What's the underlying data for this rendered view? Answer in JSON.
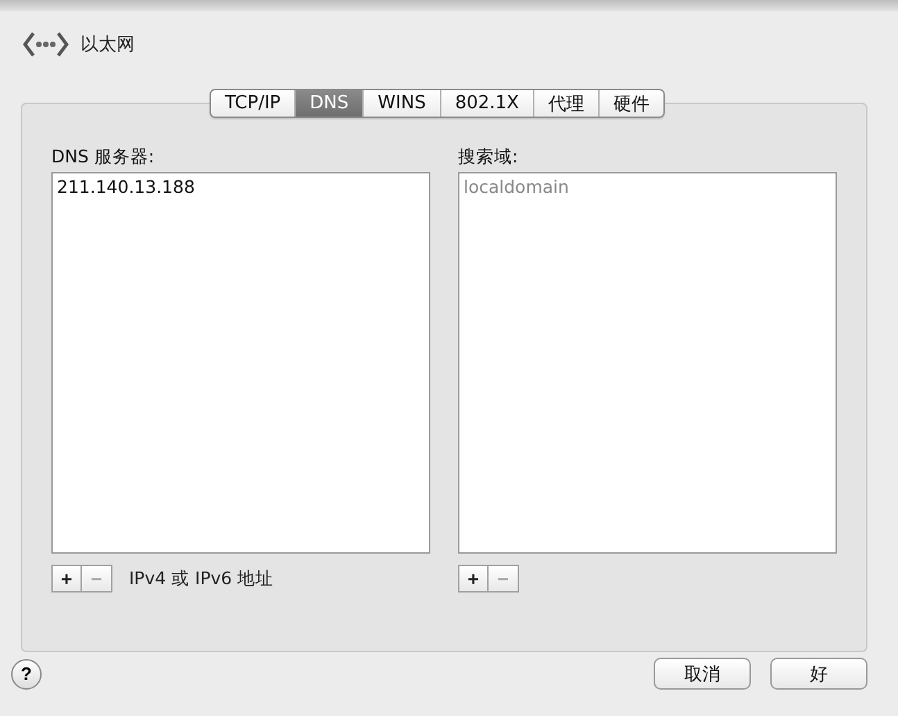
{
  "header": {
    "title": "以太网"
  },
  "tabs": [
    {
      "label": "TCP/IP",
      "selected": false
    },
    {
      "label": "DNS",
      "selected": true
    },
    {
      "label": "WINS",
      "selected": false
    },
    {
      "label": "802.1X",
      "selected": false
    },
    {
      "label": "代理",
      "selected": false
    },
    {
      "label": "硬件",
      "selected": false
    }
  ],
  "dns_servers": {
    "label": "DNS 服务器:",
    "items": [
      {
        "text": "211.140.13.188",
        "dimmed": false
      }
    ],
    "buttons": [
      {
        "label": "+",
        "disabled": false
      },
      {
        "label": "−",
        "disabled": true
      }
    ],
    "hint": "IPv4 或 IPv6 地址"
  },
  "search_domains": {
    "label": "搜索域:",
    "items": [
      {
        "text": "localdomain",
        "dimmed": true
      }
    ],
    "buttons": [
      {
        "label": "+",
        "disabled": false
      },
      {
        "label": "−",
        "disabled": true
      }
    ]
  },
  "help": {
    "label": "?"
  },
  "buttons": [
    {
      "label": "取消"
    },
    {
      "label": "好"
    }
  ]
}
